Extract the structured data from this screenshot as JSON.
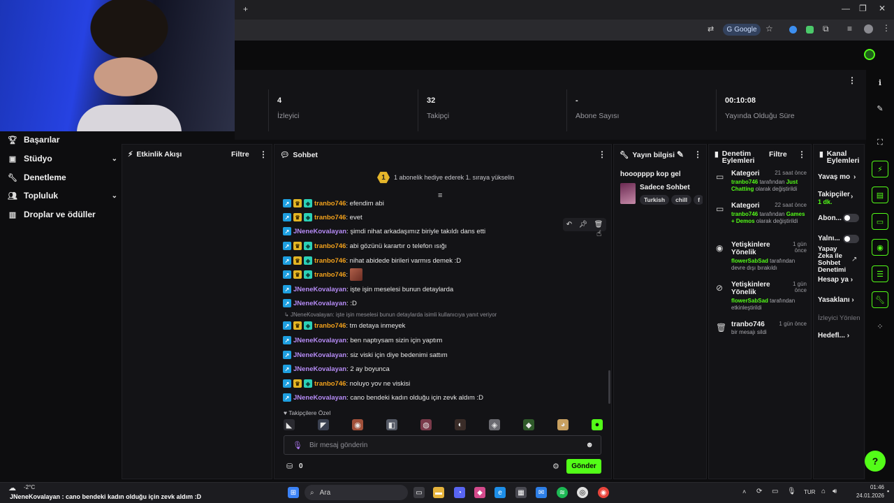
{
  "browser": {
    "new_tab_icon": "plus-icon",
    "google_label": "Google",
    "window_controls": [
      "minimize-icon",
      "maximize-icon",
      "close-icon"
    ]
  },
  "stats": [
    {
      "value": "4",
      "label": "İzleyici"
    },
    {
      "value": "32",
      "label": "Takipçi"
    },
    {
      "value": "-",
      "label": "Abone Sayısı"
    },
    {
      "value": "00:10:08",
      "label": "Yayında Olduğu Süre"
    }
  ],
  "nav": [
    {
      "label": "Başarılar",
      "icon": "trophy-icon",
      "expandable": false
    },
    {
      "label": "Stüdyo",
      "icon": "video-icon",
      "expandable": true
    },
    {
      "label": "Denetleme",
      "icon": "wrench-icon",
      "expandable": false
    },
    {
      "label": "Topluluk",
      "icon": "people-icon",
      "expandable": true
    },
    {
      "label": "Droplar ve ödüller",
      "icon": "gift-icon",
      "expandable": false
    }
  ],
  "activity_panel": {
    "title": "Etkinlik Akışı",
    "filter": "Filtre"
  },
  "chat": {
    "title": "Sohbet",
    "banner_number": "1",
    "banner_text": "1 abonelik hediye ederek 1. sıraya yükselin",
    "messages": [
      {
        "user": "tranbo746",
        "text": ": efendim abi",
        "color": "orange",
        "badges": 3
      },
      {
        "user": "tranbo746",
        "text": ": evet",
        "color": "orange",
        "badges": 3
      },
      {
        "user": "JNeneKovalayan",
        "text": ": şimdi nihat arkadaşımız biriyle takıldı dans etti",
        "color": "purple",
        "badges": 1
      },
      {
        "user": "tranbo746",
        "text": ": abi gözünü karartır o telefon ısığı",
        "color": "orange",
        "badges": 3
      },
      {
        "user": "tranbo746",
        "text": ": nihat abidede birileri varmıs demek :D",
        "color": "orange",
        "badges": 3
      },
      {
        "user": "tranbo746",
        "text": ":",
        "color": "orange",
        "badges": 3,
        "emote": true
      },
      {
        "user": "JNeneKovalayan",
        "text": ": işte işin meselesi bunun detaylarda",
        "color": "purple",
        "badges": 1
      },
      {
        "user": "JNeneKovalayan",
        "text": ": :D",
        "color": "purple",
        "badges": 1
      },
      {
        "user": "tranbo746",
        "text": ": tm detaya inmeyek",
        "color": "orange",
        "badges": 3
      },
      {
        "user": "JNeneKovalayan",
        "text": ": ben naptıysam sizin için yaptım",
        "color": "purple",
        "badges": 1
      },
      {
        "user": "JNeneKovalayan",
        "text": ": siz viski için diye bedenimi sattım",
        "color": "purple",
        "badges": 1
      },
      {
        "user": "JNeneKovalayan",
        "text": ": 2 ay boyunca",
        "color": "purple",
        "badges": 1
      },
      {
        "user": "tranbo746",
        "text": ": noluyo yov ne viskisi",
        "color": "orange",
        "badges": 3
      },
      {
        "user": "JNeneKovalayan",
        "text": ": cano bendeki kadın olduğu için zevk aldım :D",
        "color": "purple",
        "badges": 1
      }
    ],
    "reply_reference": "JNeneKovalayan: işte işin meselesi bunun detaylarda isimli kullanıcıya yanıt veriyor",
    "emote_section": "Takipçilere Özel",
    "input_placeholder": "Bir mesaj gönderin",
    "points": "0",
    "send_label": "Gönder"
  },
  "stream_info": {
    "title": "Yayın bilgisi",
    "stream_title": "hooopppp kop gel",
    "category": "Sadece Sohbet",
    "tags": [
      "Turkish",
      "chill",
      "f"
    ]
  },
  "mod_actions": {
    "title": "Denetim Eylemleri",
    "filter": "Filtre",
    "entries": [
      {
        "icon": "category-icon",
        "title": "Kategori",
        "time": "21 saat önce",
        "actor": "tranbo746",
        "mid": " tarafından ",
        "target": "Just Chatting",
        "tail": " olarak değiştirildi"
      },
      {
        "icon": "category-icon",
        "title": "Kategori",
        "time": "22 saat önce",
        "actor": "tranbo746",
        "mid": " tarafından ",
        "target": "Games + Demos",
        "tail": " olarak değiştirildi"
      },
      {
        "icon": "eye-icon",
        "title": "Yetişkinlere Yönelik",
        "time": "1 gün önce",
        "actor": "flowerSabSad",
        "mid": " tarafından devre dışı bırakıldı",
        "target": "",
        "tail": ""
      },
      {
        "icon": "eye-off-icon",
        "title": "Yetişkinlere Yönelik",
        "time": "1 gün önce",
        "actor": "flowerSabSad",
        "mid": " tarafından etkinleştirildi",
        "target": "",
        "tail": ""
      },
      {
        "icon": "trash-icon",
        "title": "tranbo746",
        "time": "1 gün önce",
        "actor": "",
        "mid": "bir mesajı sildi",
        "target": "",
        "tail": ""
      }
    ]
  },
  "channel_actions": {
    "title": "Kanal Eylemleri",
    "items": [
      "Yavaş mo",
      "Takipçiler",
      "1 dk.",
      "Abon...",
      "Yalnı...",
      "Yapay Zeka ile Sohbet Denetimi",
      "Hesap ya",
      "Yasaklanı",
      "İzleyici Yönlen",
      "Hedefl..."
    ]
  },
  "taskbar": {
    "weather_temp": "-2°C",
    "search_label": "Ara",
    "lang": "TUR",
    "time": "01:46",
    "date": "24.01.2026",
    "overlay_user": "JNeneKovalayan",
    "overlay_text": " : cano bendeki kadın olduğu için zevk aldım :D"
  },
  "colors": {
    "accent": "#53fc18",
    "orange_user": "#f3a21c",
    "purple_user": "#b58bf5"
  }
}
